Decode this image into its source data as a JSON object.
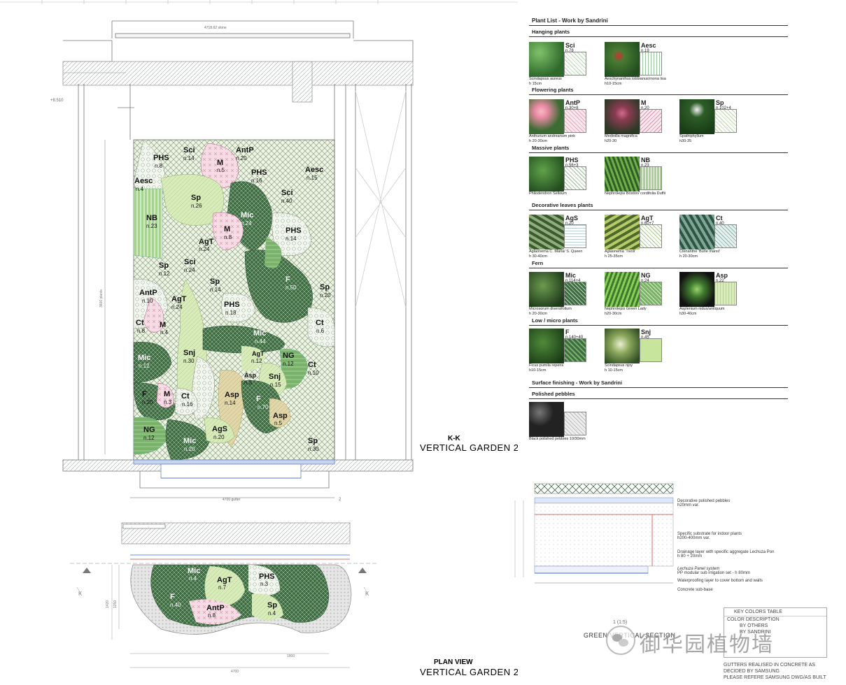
{
  "elevation": {
    "section_mark": "K-K",
    "title": "VERTICAL GARDEN 2",
    "dim_top": "4718.62 stone",
    "dim_gutter": "4700 gutter",
    "level": "+8.510",
    "dim_vertical": "3600 plants",
    "dim_small": "2",
    "zones": [
      {
        "code": "PHS",
        "count": "n.8"
      },
      {
        "code": "Sci",
        "count": "n.14"
      },
      {
        "code": "M",
        "count": "n.5"
      },
      {
        "code": "AntP",
        "count": "n.20"
      },
      {
        "code": "PHS",
        "count": "n.16"
      },
      {
        "code": "Aesc",
        "count": "n.15"
      },
      {
        "code": "Aesc",
        "count": "n.4"
      },
      {
        "code": "Sp",
        "count": "n.26"
      },
      {
        "code": "Sci",
        "count": "n.40"
      },
      {
        "code": "NB",
        "count": "n.23"
      },
      {
        "code": "Mic",
        "count": "n.24"
      },
      {
        "code": "M",
        "count": "n.8"
      },
      {
        "code": "PHS",
        "count": "n.14"
      },
      {
        "code": "AgT",
        "count": "n.24"
      },
      {
        "code": "Sp",
        "count": "n.12"
      },
      {
        "code": "Sci",
        "count": "n.24"
      },
      {
        "code": "Sp",
        "count": "n.14"
      },
      {
        "code": "F",
        "count": "n.50"
      },
      {
        "code": "Sp",
        "count": "n.20"
      },
      {
        "code": "AntP",
        "count": "n.10"
      },
      {
        "code": "AgT",
        "count": "n.24"
      },
      {
        "code": "PHS",
        "count": "n.18"
      },
      {
        "code": "Ct",
        "count": "n.8"
      },
      {
        "code": "M",
        "count": "n.4"
      },
      {
        "code": "Mic",
        "count": "n.44"
      },
      {
        "code": "Ct",
        "count": "n.6"
      },
      {
        "code": "Snj",
        "count": "n.30"
      },
      {
        "code": "AgT",
        "count": "n.12"
      },
      {
        "code": "NG",
        "count": "n.12"
      },
      {
        "code": "Mic",
        "count": "n.12"
      },
      {
        "code": "Asp",
        "count": "n.3"
      },
      {
        "code": "Snj",
        "count": "n.15"
      },
      {
        "code": "Ct",
        "count": "n.10"
      },
      {
        "code": "F",
        "count": "n.20"
      },
      {
        "code": "M",
        "count": "n.3"
      },
      {
        "code": "Ct",
        "count": "n.16"
      },
      {
        "code": "Asp",
        "count": "n.14"
      },
      {
        "code": "F",
        "count": "n.70"
      },
      {
        "code": "Asp",
        "count": "n.5"
      },
      {
        "code": "NG",
        "count": "n.12"
      },
      {
        "code": "AgS",
        "count": "n.20"
      },
      {
        "code": "Mic",
        "count": "n.20"
      },
      {
        "code": "Sp",
        "count": "n.30"
      }
    ]
  },
  "plan": {
    "title_line1": "PLAN VIEW",
    "title_line2": "VERTICAL GARDEN 2",
    "k_mark": "K",
    "dim_a": "1420",
    "dim_b": "1250",
    "dim_c": "1800",
    "dim_d": "4700",
    "zones": [
      {
        "code": "Mic",
        "count": "n.4"
      },
      {
        "code": "AgT",
        "count": "n.7"
      },
      {
        "code": "PHS",
        "count": "n.3"
      },
      {
        "code": "F",
        "count": "n.40"
      },
      {
        "code": "Sp",
        "count": "n.4"
      },
      {
        "code": "AntP",
        "count": "n.8"
      }
    ]
  },
  "plant_list": {
    "title": "Plant List - Work by Sandrini",
    "sections": [
      {
        "name": "Hanging plants",
        "plants": [
          {
            "code": "Sci",
            "count": "n.78",
            "name": "Scindapsus aureus",
            "size": "h 15cm"
          },
          {
            "code": "Aesc",
            "count": "n.19",
            "name": "Aeschynanthus lobbianus/mona lisa",
            "size": "h10-15cm"
          }
        ]
      },
      {
        "name": "Flowering plants",
        "plants": [
          {
            "code": "AntP",
            "count": "n.30+8",
            "name": "Anthurium andreanum pink",
            "size": "h 20-30cm"
          },
          {
            "code": "M",
            "count": "n.20",
            "name": "Medinilla magnifica",
            "size": "h20-30"
          },
          {
            "code": "Sp",
            "count": "n.102+4",
            "name": "Spathiphyllum",
            "size": "h30-35"
          }
        ]
      },
      {
        "name": "Massive plants",
        "plants": [
          {
            "code": "PHS",
            "count": "n.56+3",
            "name": "Philodendron Selloum",
            "size": ""
          },
          {
            "code": "NB",
            "count": "n.23",
            "name": "Nephrolepis Boston/ cordifolia Duffii",
            "size": ""
          }
        ]
      },
      {
        "name": "Decorative leaves plants",
        "plants": [
          {
            "code": "AgS",
            "count": "n.20",
            "name": "Aglaonema C. Maria/ S. Queen",
            "size": "h 30-40cm"
          },
          {
            "code": "AgT",
            "count": "n.60+7",
            "name": "Aglaonema 'Tivoli'",
            "size": "h 25-35cm"
          },
          {
            "code": "Ct",
            "count": "n.40",
            "name": "Ctenanthe 'Burle marxii'",
            "size": "h 20-30cm"
          }
        ]
      },
      {
        "name": "Fern",
        "plants": [
          {
            "code": "Mic",
            "count": "n.114+4",
            "name": "Microsorum diversifolium",
            "size": "h 20-30cm"
          },
          {
            "code": "NG",
            "count": "n.24",
            "name": "Nephrolepis Green Lady",
            "size": "h20-30cm"
          },
          {
            "code": "Asp",
            "count": "n.22",
            "name": "Asplenium nidus/antiquum",
            "size": "h30-40cm"
          }
        ]
      },
      {
        "name": "Low / micro plants",
        "plants": [
          {
            "code": "F",
            "count": "n.140+40",
            "name": "Ficus pumila repens",
            "size": "h10-15cm"
          },
          {
            "code": "Snj",
            "count": "n.45",
            "name": "Scindapsus njoy",
            "size": "h 10-15cm"
          }
        ]
      }
    ],
    "surface_title": "Surface finishing - Work by Sandrini",
    "surface_section": "Polished pebbles",
    "pebbles_name": "Black polished pebbles 10/30mm"
  },
  "section_detail": {
    "title": "GREEN VERTICAL SECTION",
    "scale": "1 (1:5)",
    "layers": [
      {
        "line1": "Decorative polished pebbles",
        "line2": "h20mm var."
      },
      {
        "line1": "Specific substrate for indoor plants",
        "line2": "h200-400mm var."
      },
      {
        "line1": "Drainage layer with specific aggregate Lechuza Pon",
        "line2": "h 80 + 20mm"
      },
      {
        "line1": "Lechuza Panel system",
        "line2": "PP modular sub irrigation set - h 80mm"
      },
      {
        "line1": "Waterproofing layer to cover bottom and walls",
        "line2": ""
      },
      {
        "line1": "Concrete sub-base",
        "line2": ""
      }
    ]
  },
  "key_table": {
    "title": "KEY COLORS TABLE",
    "rows": [
      "COLOR DESCRIPTION",
      "BY OTHERS",
      "BY SANDRINI"
    ]
  },
  "watermark": "御华园植物墙",
  "notes": [
    "GUTTERS REALISED IN CONCRETE AS",
    "DECIDED BY SAMSUNG",
    "PLEASE REFERE SAMSUNG DWG/AS BUILT"
  ],
  "colors": {
    "dark_green": "#3f6b45",
    "mid_green": "#79b36b",
    "light_green": "#cfe6a8",
    "pink": "#f4d6df",
    "pale": "#eef3e6",
    "tan": "#d9cfa0"
  }
}
